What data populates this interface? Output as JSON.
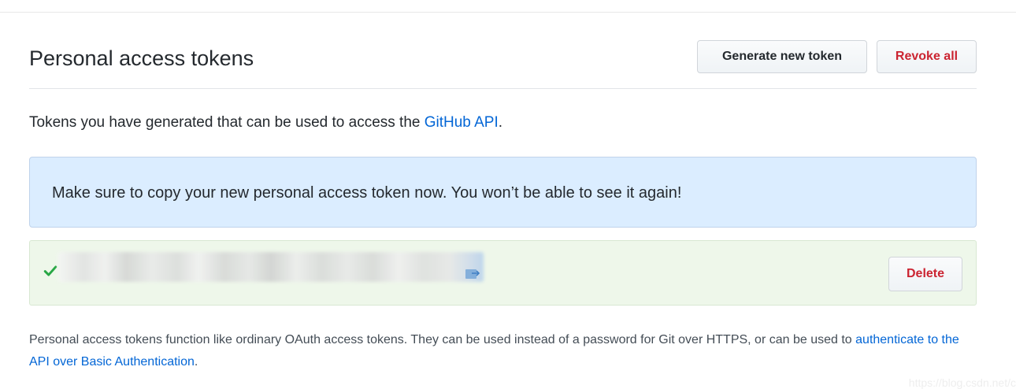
{
  "header": {
    "title": "Personal access tokens",
    "generate_label": "Generate new token",
    "revoke_label": "Revoke all"
  },
  "intro": {
    "prefix": "Tokens you have generated that can be used to access the ",
    "link": "GitHub API",
    "suffix": "."
  },
  "flash": {
    "message": "Make sure to copy your new personal access token now. You won’t be able to see it again!"
  },
  "token": {
    "delete_label": "Delete"
  },
  "note": {
    "text": "Personal access tokens function like ordinary OAuth access tokens. They can be used instead of a password for Git over HTTPS, or can be used to ",
    "link": "authenticate to the API over Basic Authentication",
    "suffix": "."
  },
  "watermark": "https://blog.csdn.net/c",
  "colors": {
    "link": "#0366d6",
    "danger": "#cb2431",
    "success": "#28a745",
    "info_bg": "#dbedff",
    "success_bg": "#eef7ea"
  },
  "icons": {
    "check": "check-icon",
    "copy": "clippy-icon"
  }
}
